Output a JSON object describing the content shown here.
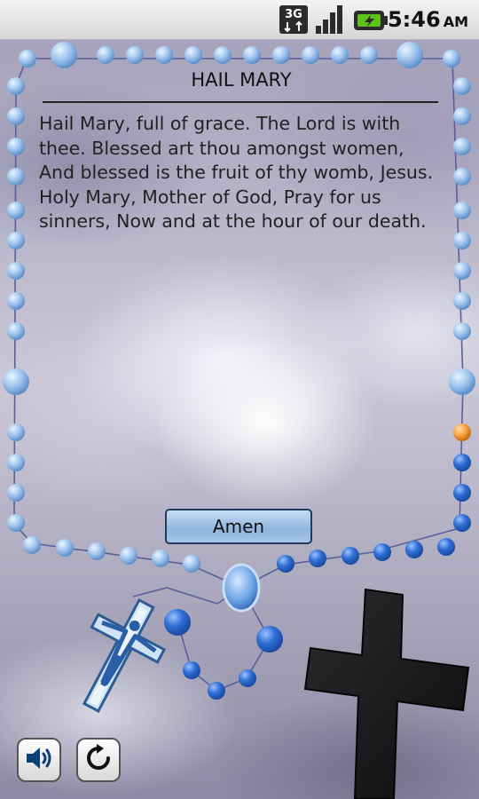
{
  "status_bar": {
    "network_label": "3G",
    "time": "5:46",
    "ampm": "AM"
  },
  "prayer": {
    "title": "HAIL MARY",
    "text": "Hail Mary, full of grace. The Lord is with thee. Blessed art thou amongst women, And blessed is the fruit of thy womb, Jesus. Holy Mary, Mother of God, Pray for us sinners, Now and at the hour of our death."
  },
  "actions": {
    "amen_label": "Amen"
  },
  "controls": {
    "sound_icon": "speaker-icon",
    "repeat_icon": "repeat-icon"
  },
  "colors": {
    "bead_light": "#9ec4ee",
    "bead_dark": "#2f6fd6",
    "bead_current": "#f5a040",
    "accent": "#8fb4de"
  },
  "rosary": {
    "decade_total": 10,
    "beads_prayed": 0,
    "current_bead": 1
  }
}
